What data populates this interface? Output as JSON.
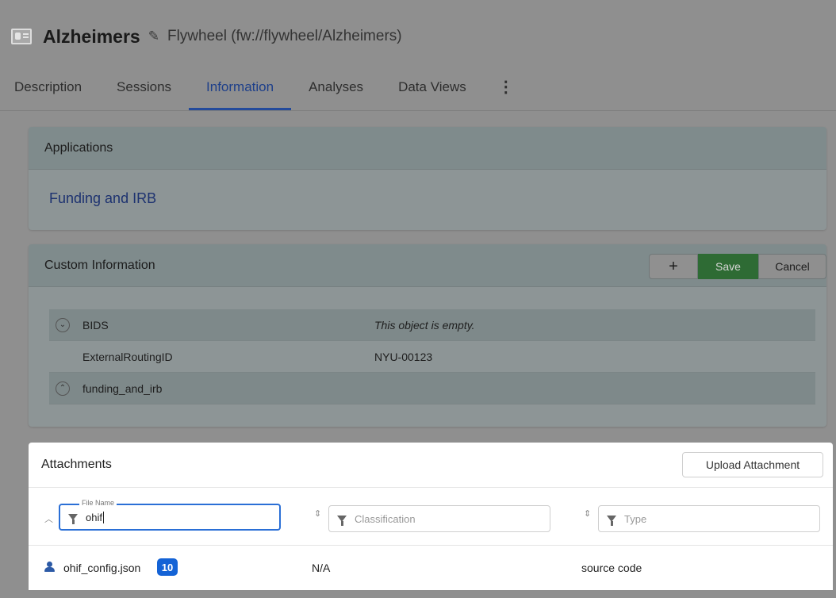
{
  "header": {
    "title": "Alzheimers",
    "subtitle": "Flywheel (fw://flywheel/Alzheimers)"
  },
  "tabs": [
    {
      "label": "Description"
    },
    {
      "label": "Sessions"
    },
    {
      "label": "Information",
      "active": true
    },
    {
      "label": "Analyses"
    },
    {
      "label": "Data Views"
    }
  ],
  "applications": {
    "title": "Applications",
    "link": "Funding and IRB"
  },
  "custom_info": {
    "title": "Custom Information",
    "add_label": "+",
    "save_label": "Save",
    "cancel_label": "Cancel",
    "rows": [
      {
        "key": "BIDS",
        "value": "This object is empty."
      },
      {
        "key": "ExternalRoutingID",
        "value": "NYU-00123"
      },
      {
        "key": "funding_and_irb",
        "value": ""
      }
    ]
  },
  "attachments": {
    "title": "Attachments",
    "upload_label": "Upload Attachment",
    "filters": {
      "file_name_label": "File Name",
      "file_name_value": "ohif",
      "classification_placeholder": "Classification",
      "type_placeholder": "Type"
    },
    "rows": [
      {
        "file_name": "ohif_config.json",
        "badge": "10",
        "classification": "N/A",
        "type": "source code"
      }
    ]
  },
  "colors": {
    "accent": "#1d3f8a",
    "save_green": "#3a8a44",
    "badge_blue": "#1463d6",
    "focus_blue": "#2a6fd6"
  }
}
